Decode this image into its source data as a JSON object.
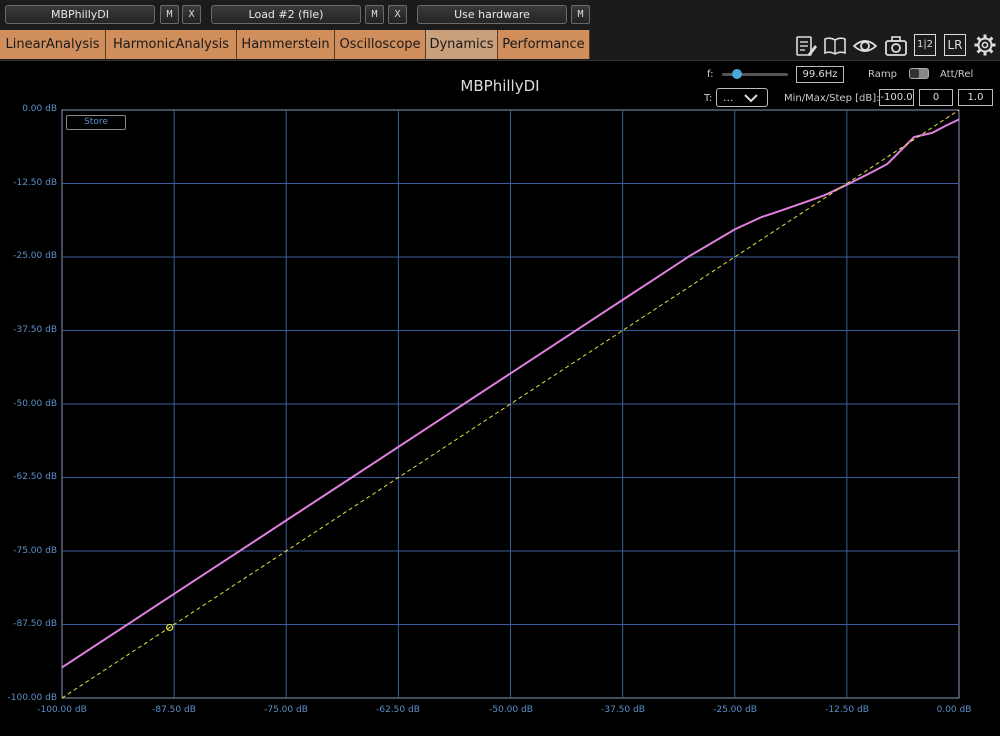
{
  "slots": [
    {
      "label": "MBPhillyDI",
      "buttons": [
        "M",
        "X"
      ]
    },
    {
      "label": "Load #2 (file)",
      "buttons": [
        "M",
        "X"
      ]
    },
    {
      "label": "Use hardware",
      "buttons": [
        "M"
      ]
    }
  ],
  "tabs": [
    "LinearAnalysis",
    "HarmonicAnalysis",
    "Hammerstein",
    "Oscilloscope",
    "Dynamics",
    "Performance"
  ],
  "active_tab": "Dynamics",
  "toolbar_icons": [
    "notes-edit-icon",
    "book-icon",
    "eye-icon",
    "camera-icon",
    "one-two-icon",
    "lr-icon",
    "gear-icon"
  ],
  "toolbar_text": {
    "one_two": "1|2",
    "lr": "LR"
  },
  "controls": {
    "f_label": "f:",
    "f_value": "99.6Hz",
    "f_slider_position": 0.23,
    "ramp_label": "Ramp",
    "att_rel_label": "Att/Rel",
    "t_label": "T:",
    "t_value": "...",
    "minmax_label": "Min/Max/Step [dB]:",
    "min": "-100.0",
    "max": "0",
    "step": "1.0",
    "store_label": "Store"
  },
  "chart_data": {
    "type": "line",
    "title": "MBPhillyDI",
    "xlim": [
      -100,
      0
    ],
    "ylim": [
      -100,
      0
    ],
    "xticks": [
      "-100.00 dB",
      "-87.50 dB",
      "-75.00 dB",
      "-62.50 dB",
      "-50.00 dB",
      "-37.50 dB",
      "-25.00 dB",
      "-12.50 dB",
      "0.00 dB"
    ],
    "yticks": [
      "0.00 dB",
      "-12.50 dB",
      "-25.00 dB",
      "-37.50 dB",
      "-50.00 dB",
      "-62.50 dB",
      "-75.00 dB",
      "-87.50 dB",
      "-100.00 dB"
    ],
    "grid": true,
    "series": [
      {
        "color": "#e080e0",
        "style": "solid",
        "x": [
          -100,
          -90,
          -80,
          -70,
          -60,
          -50,
          -40,
          -30,
          -25,
          -22,
          -20,
          -17,
          -15,
          -12.5,
          -10,
          -8,
          -5,
          -3,
          -1.5,
          0
        ],
        "y": [
          -94.8,
          -84.8,
          -74.8,
          -64.8,
          -54.8,
          -44.8,
          -34.8,
          -24.8,
          -20.3,
          -18.2,
          -17.2,
          -15.6,
          -14.5,
          -12.7,
          -10.8,
          -9.2,
          -4.6,
          -3.9,
          -2.7,
          -1.6
        ]
      },
      {
        "color": "#e0e040",
        "style": "dashed",
        "x": [
          -100,
          0
        ],
        "y": [
          -100,
          0
        ]
      }
    ],
    "marker": {
      "x": -88,
      "y": -88,
      "color": "#e0e040"
    }
  }
}
